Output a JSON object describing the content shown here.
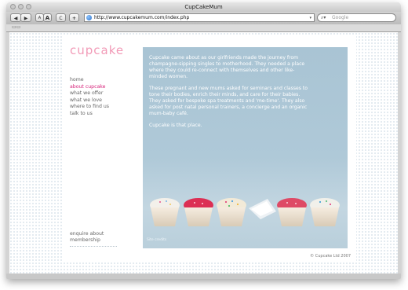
{
  "window": {
    "title": "CupCakeMum"
  },
  "toolbar": {
    "back_label": "◀",
    "forward_label": "▶",
    "text_small": "A",
    "text_large": "A",
    "reload_label": "C",
    "add_label": "+",
    "url": "http://www.cupcakemum.com/index.php",
    "search_placeholder": "Google"
  },
  "site": {
    "logo": "cupcake",
    "nav": [
      "home",
      "about cupcake",
      "what we offer",
      "what we love",
      "where to find us",
      "talk to us"
    ],
    "nav_active_index": 1,
    "enquire": [
      "enquire about",
      "membership"
    ],
    "paragraphs": [
      "Cupcake came about as our girlfriends made the journey from champagne-sipping singles to motherhood. They needed a place where they could re-connect with themselves and other like-minded women.",
      "These pregnant and new mums asked for seminars and classes to tone their bodies, enrich their minds, and care for their babies. They asked for bespoke spa treatments and 'me-time'. They also asked for post natal personal trainers, a concierge and an organic mum-baby café.",
      "Cupcake is that place."
    ],
    "credits": "Site credits",
    "copyright": "© Cupcake Ltd 2007"
  },
  "colors": {
    "accent": "#f29ab7",
    "active_nav": "#d6237a",
    "photo_bg": "#aec8d7"
  }
}
